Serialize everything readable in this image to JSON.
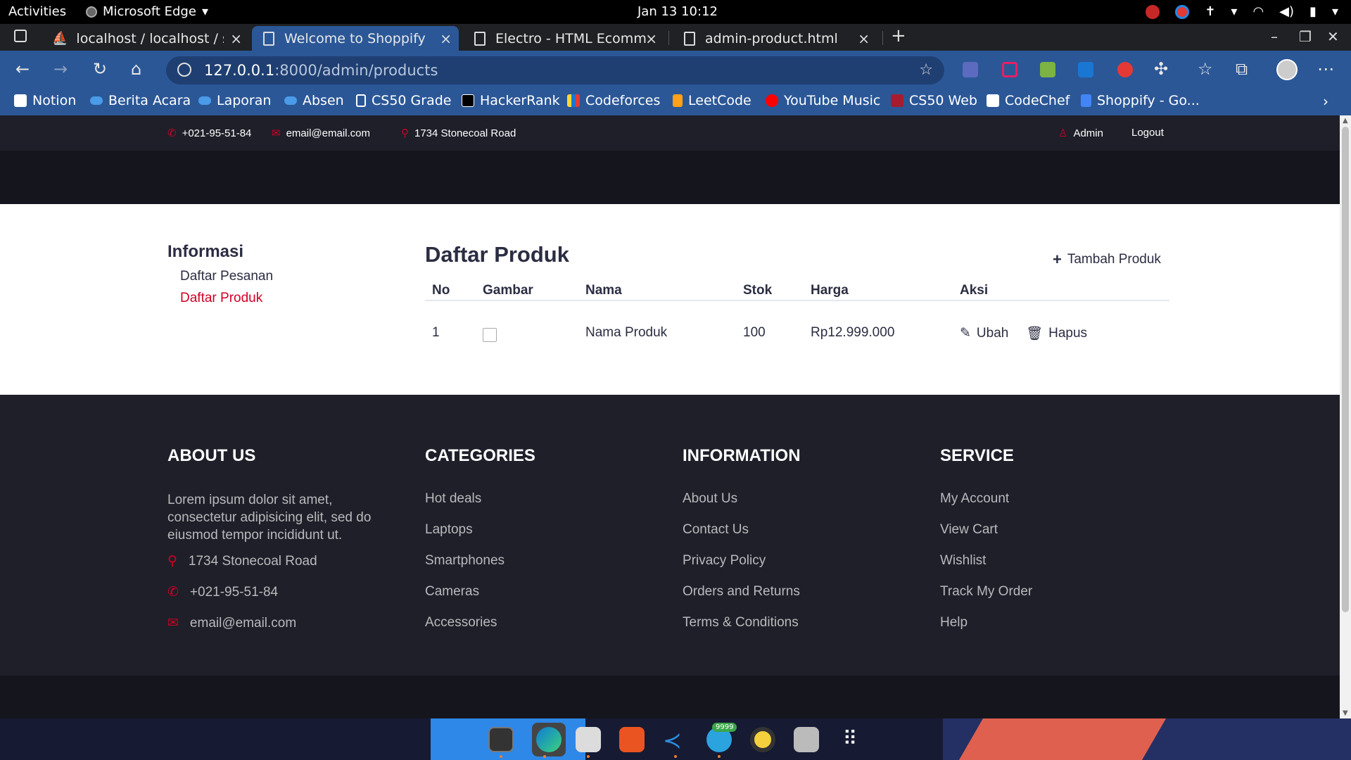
{
  "system_bar": {
    "activities": "Activities",
    "app_name": "Microsoft Edge",
    "clock": "Jan 13  10:12"
  },
  "tabs": [
    {
      "title": "localhost / localhost / shop"
    },
    {
      "title": "Welcome to Shoppify"
    },
    {
      "title": "Electro - HTML Ecommerce"
    },
    {
      "title": "admin-product.html"
    }
  ],
  "address_bar": {
    "host": "127.0.0.1",
    "path": ":8000/admin/products"
  },
  "bookmarks": [
    {
      "label": "Notion"
    },
    {
      "label": "Berita Acara"
    },
    {
      "label": "Laporan"
    },
    {
      "label": "Absen"
    },
    {
      "label": "CS50 Grade"
    },
    {
      "label": "HackerRank"
    },
    {
      "label": "Codeforces"
    },
    {
      "label": "LeetCode"
    },
    {
      "label": "YouTube Music"
    },
    {
      "label": "CS50 Web"
    },
    {
      "label": "CodeChef"
    },
    {
      "label": "Shoppify - Go..."
    }
  ],
  "header": {
    "phone": "+021-95-51-84",
    "email": "email@email.com",
    "address": "1734 Stonecoal Road",
    "admin": "Admin",
    "logout": "Logout"
  },
  "sidebar": {
    "title": "Informasi",
    "items": [
      {
        "label": "Daftar Pesanan"
      },
      {
        "label": "Daftar Produk"
      }
    ]
  },
  "main": {
    "title": "Daftar Produk",
    "add_button": "Tambah Produk",
    "table": {
      "columns": [
        "No",
        "Gambar",
        "Nama",
        "Stok",
        "Harga",
        "Aksi"
      ],
      "rows": [
        {
          "no": "1",
          "name": "Nama Produk",
          "stock": "100",
          "price": "Rp12.999.000",
          "edit": "Ubah",
          "delete": "Hapus"
        }
      ]
    }
  },
  "footer": {
    "about": {
      "title": "ABOUT US",
      "text": "Lorem ipsum dolor sit amet, consectetur adipisicing elit, sed do eiusmod tempor incididunt ut.",
      "address": "1734 Stonecoal Road",
      "phone": "+021-95-51-84",
      "email": "email@email.com"
    },
    "categories": {
      "title": "CATEGORIES",
      "links": [
        "Hot deals",
        "Laptops",
        "Smartphones",
        "Cameras",
        "Accessories"
      ]
    },
    "information": {
      "title": "INFORMATION",
      "links": [
        "About Us",
        "Contact Us",
        "Privacy Policy",
        "Orders and Returns",
        "Terms & Conditions"
      ]
    },
    "service": {
      "title": "SERVICE",
      "links": [
        "My Account",
        "View Cart",
        "Wishlist",
        "Track My Order",
        "Help"
      ]
    }
  },
  "dock": {
    "telegram_badge": "9999"
  },
  "colors": {
    "accent": "#d10024",
    "dark": "#1e1f29",
    "text": "#2b2d42",
    "browser_blue": "#2b5797"
  }
}
